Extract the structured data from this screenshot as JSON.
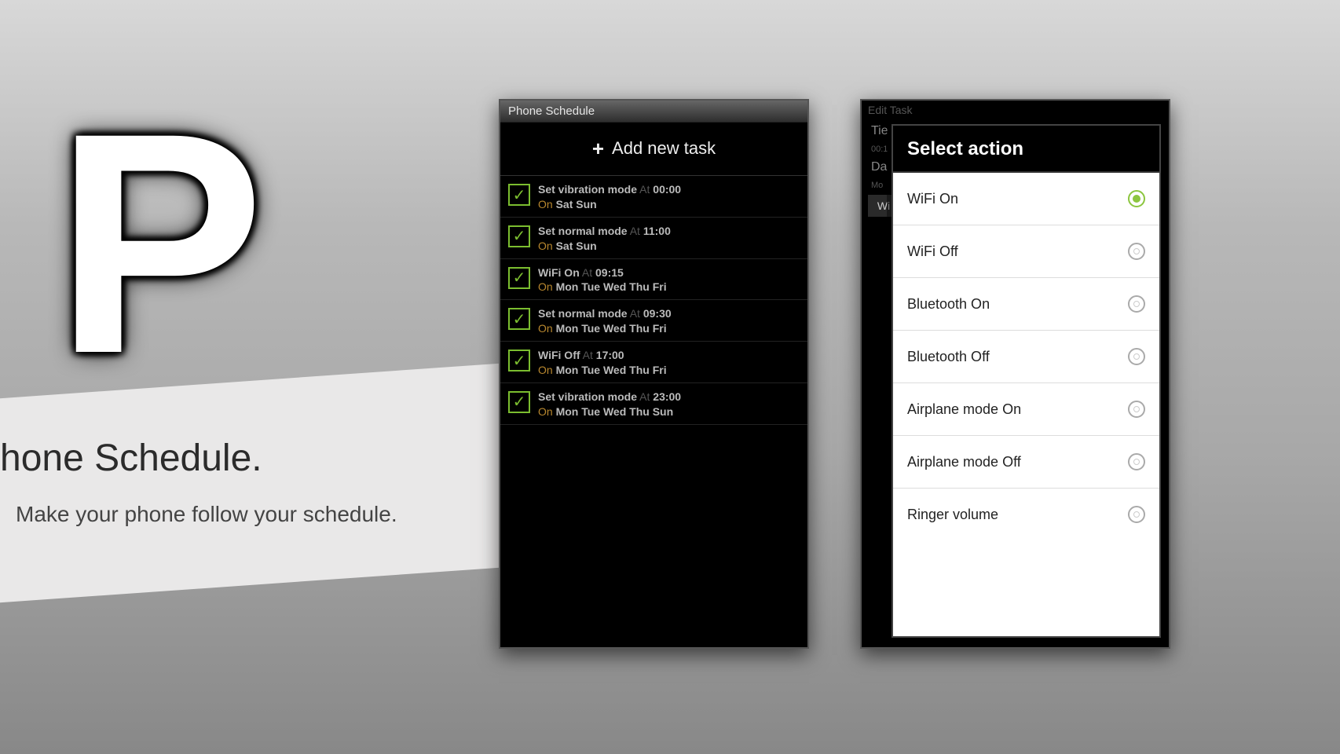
{
  "promo": {
    "logo_letter": "P",
    "title": "hone Schedule.",
    "subtitle": "Make your phone follow your schedule."
  },
  "phone1": {
    "header": "Phone Schedule",
    "add_label": "Add new task",
    "tasks": [
      {
        "name": "Set vibration mode",
        "at": "At",
        "time": "00:00",
        "on": "On",
        "days": "Sat Sun"
      },
      {
        "name": "Set normal mode",
        "at": "At",
        "time": "11:00",
        "on": "On",
        "days": "Sat Sun"
      },
      {
        "name": "WiFi On",
        "at": "At",
        "time": "09:15",
        "on": "On",
        "days": "Mon Tue Wed Thu Fri"
      },
      {
        "name": "Set normal mode",
        "at": "At",
        "time": "09:30",
        "on": "On",
        "days": "Mon Tue Wed Thu Fri"
      },
      {
        "name": "WiFi Off",
        "at": "At",
        "time": "17:00",
        "on": "On",
        "days": "Mon Tue Wed Thu Fri"
      },
      {
        "name": "Set vibration mode",
        "at": "At",
        "time": "23:00",
        "on": "On",
        "days": "Mon Tue Wed Thu Sun"
      }
    ]
  },
  "phone2": {
    "bg_header": "Edit Task",
    "bg_field_time_label": "Tie",
    "bg_field_time_value": "00:1",
    "bg_field_days_label": "Da",
    "bg_field_days_value": "Mo",
    "bg_button": "Wi",
    "dialog": {
      "title": "Select action",
      "options": [
        {
          "label": "WiFi On",
          "selected": true
        },
        {
          "label": "WiFi Off",
          "selected": false
        },
        {
          "label": "Bluetooth On",
          "selected": false
        },
        {
          "label": "Bluetooth Off",
          "selected": false
        },
        {
          "label": "Airplane mode On",
          "selected": false
        },
        {
          "label": "Airplane mode Off",
          "selected": false
        },
        {
          "label": "Ringer volume",
          "selected": false
        }
      ]
    }
  }
}
